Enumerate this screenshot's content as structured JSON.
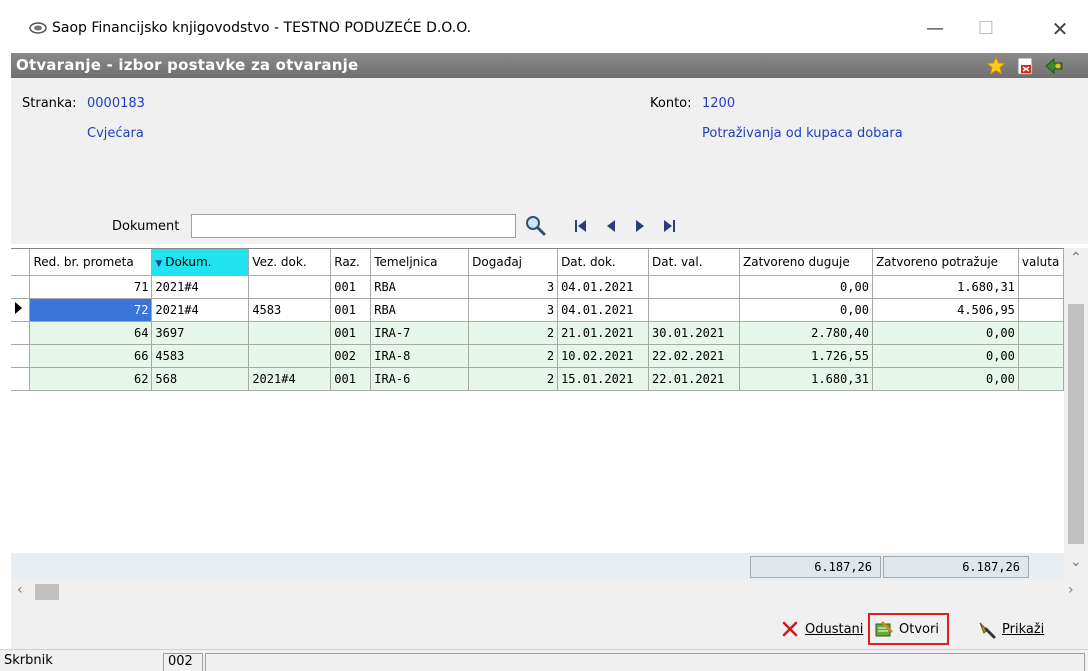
{
  "window": {
    "title": "Saop Financijsko knjigovodstvo - TESTNO PODUZEĆE D.O.O."
  },
  "form": {
    "title": "Otvaranje - izbor postavke za otvaranje"
  },
  "info": {
    "stranka_label": "Stranka:",
    "stranka_code": "0000183",
    "stranka_name": "Cvjećara",
    "konto_label": "Konto:",
    "konto_code": "1200",
    "konto_name": "Potraživanja od kupaca dobara"
  },
  "search": {
    "label": "Dokument",
    "value": ""
  },
  "grid": {
    "columns": [
      "Red. br. prometa",
      "Dokum.",
      "Vez. dok.",
      "Raz.",
      "Temeljnica",
      "Događaj",
      "Dat. dok.",
      "Dat. val.",
      "Zatvoreno duguje",
      "Zatvoreno potražuje",
      "valuta"
    ],
    "rows": [
      {
        "red": "71",
        "dokum": "2021#4",
        "vez": "",
        "raz": "001",
        "tem": "RBA",
        "dog": "3",
        "datdok": "04.01.2021",
        "datval": "",
        "dug": "0,00",
        "pot": "1.680,31"
      },
      {
        "red": "72",
        "dokum": "2021#4",
        "vez": "4583",
        "raz": "001",
        "tem": "RBA",
        "dog": "3",
        "datdok": "04.01.2021",
        "datval": "",
        "dug": "0,00",
        "pot": "4.506,95"
      },
      {
        "red": "64",
        "dokum": "3697",
        "vez": "",
        "raz": "001",
        "tem": "IRA-7",
        "dog": "2",
        "datdok": "21.01.2021",
        "datval": "30.01.2021",
        "dug": "2.780,40",
        "pot": "0,00"
      },
      {
        "red": "66",
        "dokum": "4583",
        "vez": "",
        "raz": "002",
        "tem": "IRA-8",
        "dog": "2",
        "datdok": "10.02.2021",
        "datval": "22.02.2021",
        "dug": "1.726,55",
        "pot": "0,00"
      },
      {
        "red": "62",
        "dokum": "568",
        "vez": "2021#4",
        "raz": "001",
        "tem": "IRA-6",
        "dog": "2",
        "datdok": "15.01.2021",
        "datval": "22.01.2021",
        "dug": "1.680,31",
        "pot": "0,00"
      }
    ],
    "totals": {
      "duguje": "6.187,26",
      "potrazuje": "6.187,26"
    }
  },
  "buttons": {
    "odustani": "Odustani",
    "otvori": "Otvori",
    "prikazi": "Prikaži"
  },
  "status": {
    "user": "Skrbnik",
    "code": "002"
  }
}
